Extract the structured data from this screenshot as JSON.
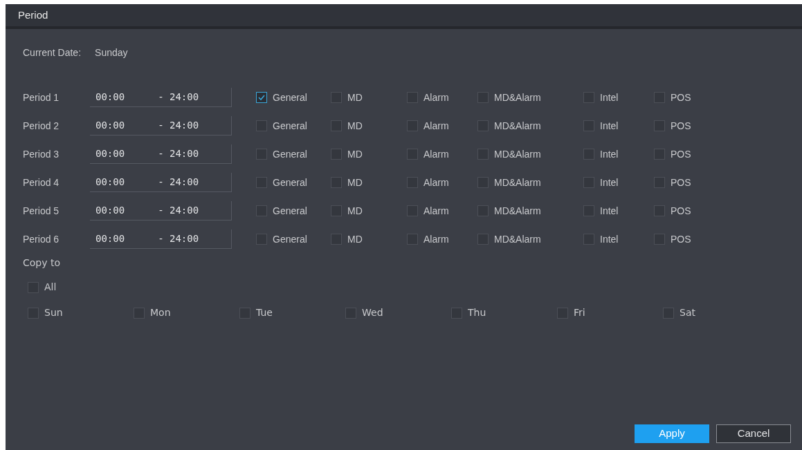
{
  "window": {
    "title": "Period"
  },
  "current_date": {
    "label": "Current Date:",
    "value": "Sunday"
  },
  "periods": [
    {
      "label": "Period 1",
      "start": "00:00",
      "end": "- 24:00",
      "types": [
        {
          "label": "General",
          "checked": true
        },
        {
          "label": "MD",
          "checked": false
        },
        {
          "label": "Alarm",
          "checked": false
        },
        {
          "label": "MD&Alarm",
          "checked": false
        },
        {
          "label": "Intel",
          "checked": false
        },
        {
          "label": "POS",
          "checked": false
        }
      ]
    },
    {
      "label": "Period 2",
      "start": "00:00",
      "end": "- 24:00",
      "types": [
        {
          "label": "General",
          "checked": false
        },
        {
          "label": "MD",
          "checked": false
        },
        {
          "label": "Alarm",
          "checked": false
        },
        {
          "label": "MD&Alarm",
          "checked": false
        },
        {
          "label": "Intel",
          "checked": false
        },
        {
          "label": "POS",
          "checked": false
        }
      ]
    },
    {
      "label": "Period 3",
      "start": "00:00",
      "end": "- 24:00",
      "types": [
        {
          "label": "General",
          "checked": false
        },
        {
          "label": "MD",
          "checked": false
        },
        {
          "label": "Alarm",
          "checked": false
        },
        {
          "label": "MD&Alarm",
          "checked": false
        },
        {
          "label": "Intel",
          "checked": false
        },
        {
          "label": "POS",
          "checked": false
        }
      ]
    },
    {
      "label": "Period 4",
      "start": "00:00",
      "end": "- 24:00",
      "types": [
        {
          "label": "General",
          "checked": false
        },
        {
          "label": "MD",
          "checked": false
        },
        {
          "label": "Alarm",
          "checked": false
        },
        {
          "label": "MD&Alarm",
          "checked": false
        },
        {
          "label": "Intel",
          "checked": false
        },
        {
          "label": "POS",
          "checked": false
        }
      ]
    },
    {
      "label": "Period 5",
      "start": "00:00",
      "end": "- 24:00",
      "types": [
        {
          "label": "General",
          "checked": false
        },
        {
          "label": "MD",
          "checked": false
        },
        {
          "label": "Alarm",
          "checked": false
        },
        {
          "label": "MD&Alarm",
          "checked": false
        },
        {
          "label": "Intel",
          "checked": false
        },
        {
          "label": "POS",
          "checked": false
        }
      ]
    },
    {
      "label": "Period 6",
      "start": "00:00",
      "end": "- 24:00",
      "types": [
        {
          "label": "General",
          "checked": false
        },
        {
          "label": "MD",
          "checked": false
        },
        {
          "label": "Alarm",
          "checked": false
        },
        {
          "label": "MD&Alarm",
          "checked": false
        },
        {
          "label": "Intel",
          "checked": false
        },
        {
          "label": "POS",
          "checked": false
        }
      ]
    }
  ],
  "copy_to": {
    "label": "Copy to",
    "all": {
      "label": "All",
      "checked": false
    },
    "days": [
      {
        "label": "Sun",
        "checked": false
      },
      {
        "label": "Mon",
        "checked": false
      },
      {
        "label": "Tue",
        "checked": false
      },
      {
        "label": "Wed",
        "checked": false
      },
      {
        "label": "Thu",
        "checked": false
      },
      {
        "label": "Fri",
        "checked": false
      },
      {
        "label": "Sat",
        "checked": false
      }
    ]
  },
  "buttons": [
    {
      "label": "Apply",
      "kind": "primary"
    },
    {
      "label": "Cancel",
      "kind": "secondary"
    }
  ]
}
